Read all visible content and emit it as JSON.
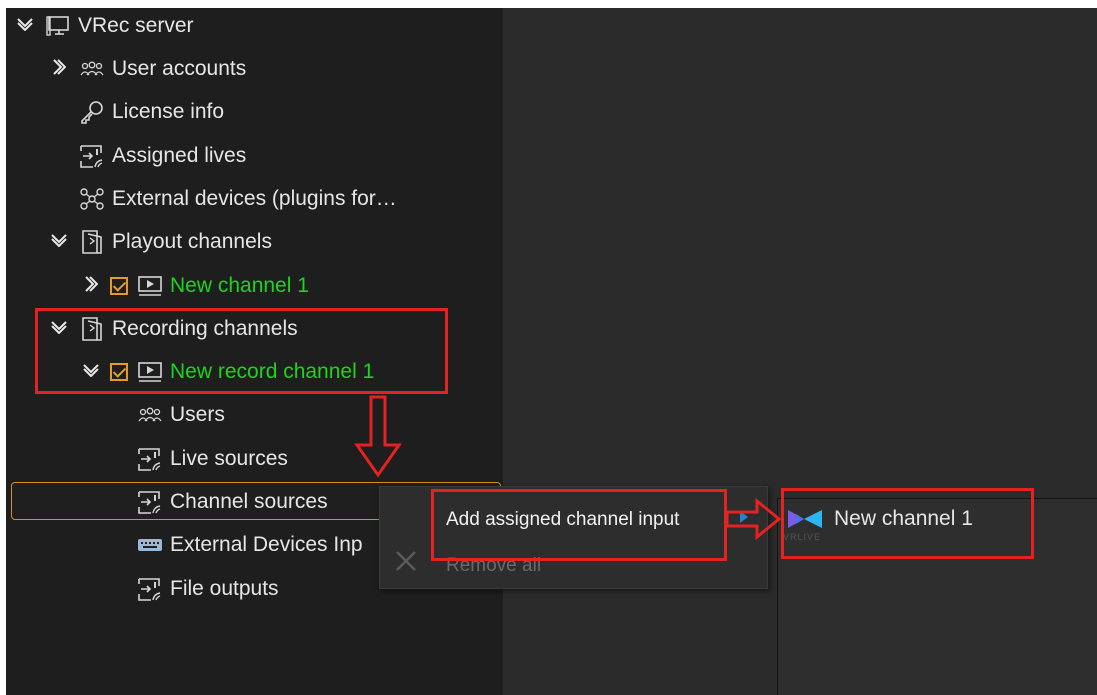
{
  "tree": {
    "server": {
      "label": "VRec server",
      "expanded": true
    },
    "user_accounts": {
      "label": "User accounts"
    },
    "license_info": {
      "label": "License info"
    },
    "assigned_lives": {
      "label": "Assigned lives"
    },
    "external_devices": {
      "label": "External devices (plugins for…"
    },
    "playout_channels": {
      "label": "Playout channels",
      "expanded": true
    },
    "playout_channel_1": {
      "label": "New channel 1",
      "checked": true
    },
    "recording_channels": {
      "label": "Recording channels",
      "expanded": true
    },
    "record_channel_1": {
      "label": "New record channel 1",
      "checked": true,
      "children": {
        "users": {
          "label": "Users"
        },
        "live_sources": {
          "label": "Live sources"
        },
        "channel_sources": {
          "label": "Channel sources",
          "selected": true
        },
        "external_devices_input": {
          "label": "External Devices Inp"
        },
        "file_outputs": {
          "label": "File outputs"
        }
      }
    }
  },
  "context_menu": {
    "items": [
      {
        "label": "Add assigned channel input",
        "enabled": true,
        "has_submenu": true
      },
      {
        "label": "Remove all",
        "enabled": false
      }
    ]
  },
  "submenu": {
    "items": [
      {
        "label": "New channel 1",
        "logo_caption": "VRLIVE"
      }
    ]
  },
  "colors": {
    "tree_background": "#1e1e1e",
    "content_background": "#2b2b2b",
    "text": "#e6e6e6",
    "active_channel_text": "#1fd31f",
    "checkbox_accent": "#e59b27",
    "selection_border": "#d58f24",
    "annotation_red": "#e32222",
    "submenu_arrow": "#2a82c8"
  }
}
